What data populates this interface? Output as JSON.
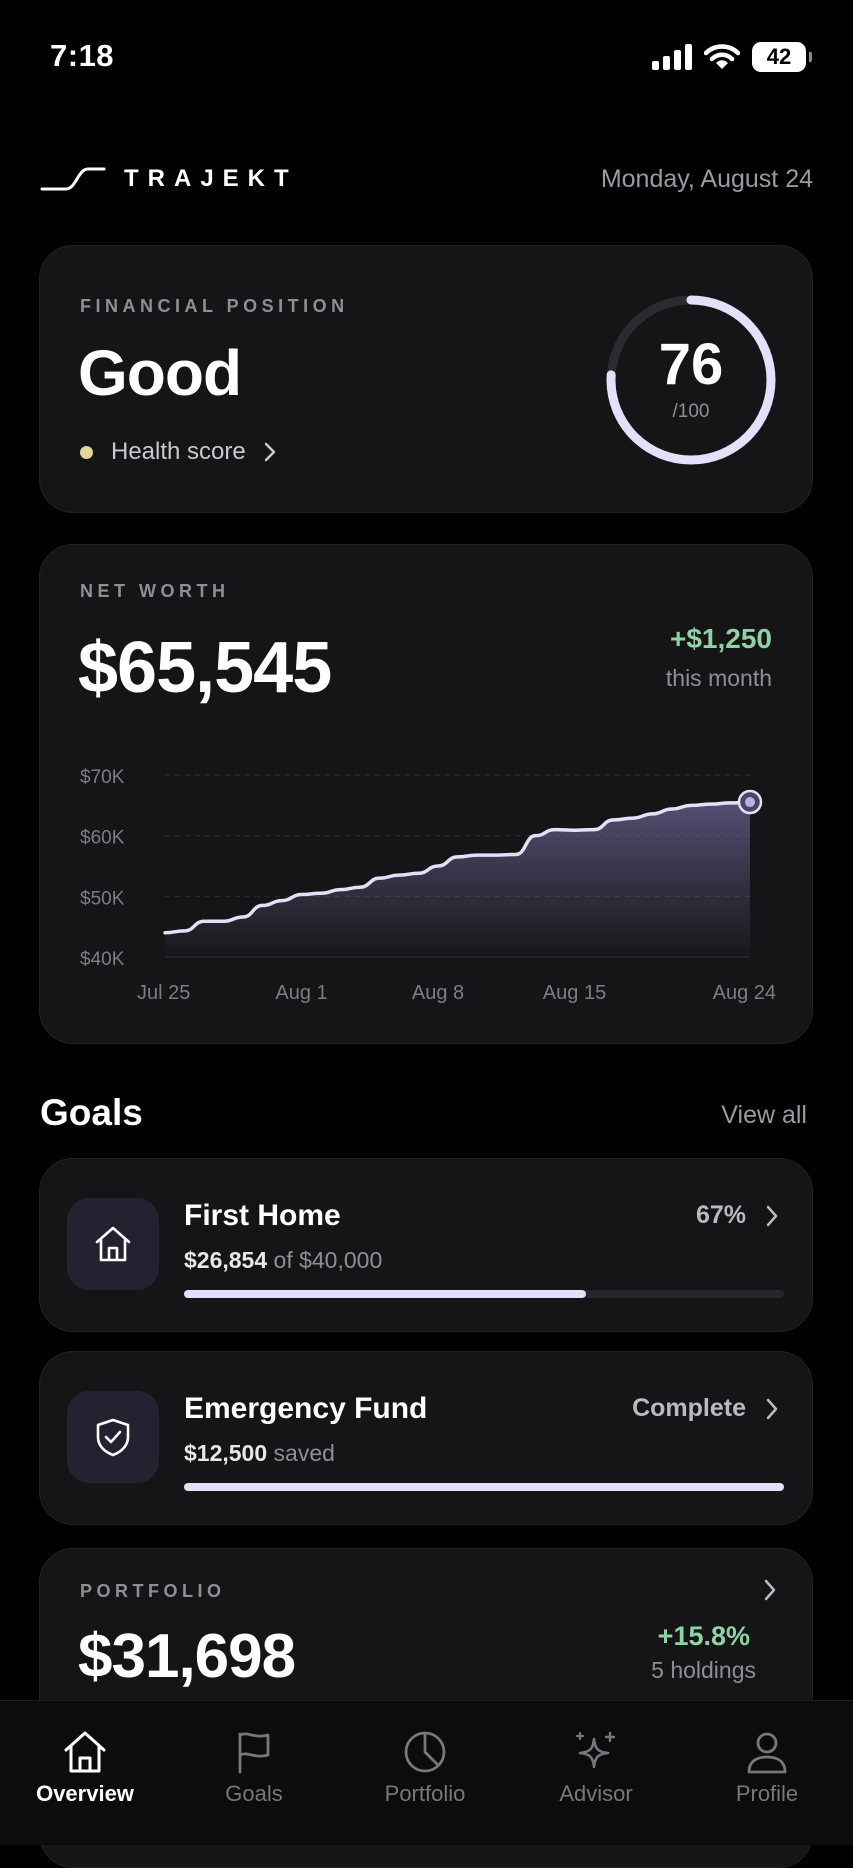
{
  "status_bar": {
    "time": "7:18",
    "battery": "42"
  },
  "header": {
    "brand": "TRAJEKT",
    "date": "Monday, August 24"
  },
  "financial_position": {
    "eyebrow": "FINANCIAL POSITION",
    "status": "Good",
    "health_label": "Health score",
    "score": "76",
    "score_max": "/100",
    "score_fraction": 0.76
  },
  "net_worth": {
    "eyebrow": "NET WORTH",
    "value": "$65,545",
    "change": "+$1,250",
    "change_sub": "this month"
  },
  "chart_data": {
    "type": "area",
    "title": "",
    "ylabel": "",
    "xlabel": "",
    "ylim": [
      40000,
      70000
    ],
    "y_ticks": [
      "$70K",
      "$60K",
      "$50K",
      "$40K"
    ],
    "y_tick_values": [
      70000,
      60000,
      50000,
      40000
    ],
    "x_tick_labels": [
      "Jul 25",
      "Aug 1",
      "Aug 8",
      "Aug 15",
      "Aug 24"
    ],
    "x_tick_days": [
      0,
      7,
      14,
      21,
      30
    ],
    "series": [
      {
        "days": [
          0,
          1,
          2,
          3,
          4,
          5,
          6,
          7,
          8,
          9,
          10,
          11,
          12,
          13,
          14,
          15,
          16,
          17,
          18,
          19,
          20,
          21,
          22,
          23,
          24,
          25,
          26,
          27,
          28,
          29,
          30
        ],
        "values": [
          44000,
          44300,
          45900,
          45900,
          46600,
          48500,
          49300,
          50300,
          50500,
          51100,
          51500,
          53000,
          53500,
          53800,
          55000,
          56500,
          56800,
          56800,
          56900,
          60000,
          61000,
          60900,
          61000,
          62600,
          62900,
          63600,
          64400,
          65000,
          65200,
          65400,
          65545
        ]
      }
    ]
  },
  "goals": {
    "title": "Goals",
    "view_all": "View all",
    "items": [
      {
        "name": "First Home",
        "amount": "$26,854",
        "amount_suffix": "of $40,000",
        "right_label": "67%",
        "progress": 0.67,
        "icon": "home-icon"
      },
      {
        "name": "Emergency Fund",
        "amount": "$12,500",
        "amount_suffix": "saved",
        "right_label": "Complete",
        "progress": 1.0,
        "icon": "shield-check-icon"
      }
    ]
  },
  "portfolio": {
    "eyebrow": "PORTFOLIO",
    "value": "$31,698",
    "change": "+15.8%",
    "holdings": "5 holdings"
  },
  "tabbar": {
    "items": [
      {
        "label": "Overview",
        "icon": "home-icon",
        "active": true
      },
      {
        "label": "Goals",
        "icon": "flag-icon",
        "active": false
      },
      {
        "label": "Portfolio",
        "icon": "pie-chart-icon",
        "active": false
      },
      {
        "label": "Advisor",
        "icon": "sparkles-icon",
        "active": false
      },
      {
        "label": "Profile",
        "icon": "person-icon",
        "active": false
      }
    ]
  },
  "colors": {
    "accent": "#e4e0fa",
    "positive": "#8fd3a5",
    "health_dot": "#e3d49a"
  }
}
